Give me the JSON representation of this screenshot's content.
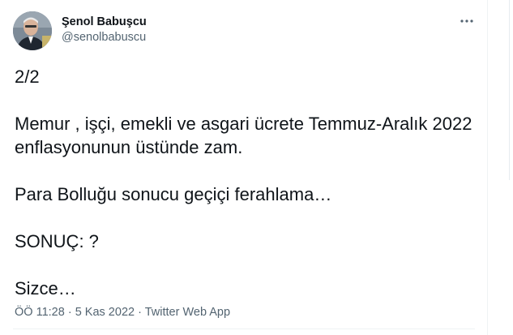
{
  "tweet": {
    "author": {
      "display_name": "Şenol Babuşcu",
      "handle": "@senolbabuscu"
    },
    "text": "2/2\n\nMemur , işçi, emekli ve asgari ücrete Temmuz-Aralık 2022 enflasyonunun üstünde zam.\n\nPara Bolluğu sonucu geçiçi ferahlama…\n\nSONUÇ: ?\n\nSizce…",
    "meta": {
      "time": "ÖÖ 11:28",
      "separator": "·",
      "date": "5 Kas 2022",
      "source": "Twitter Web App"
    },
    "more_icon": "more-horizontal-icon"
  },
  "colors": {
    "text_primary": "#0f1419",
    "text_secondary": "#536471",
    "divider": "#eff3f4"
  }
}
